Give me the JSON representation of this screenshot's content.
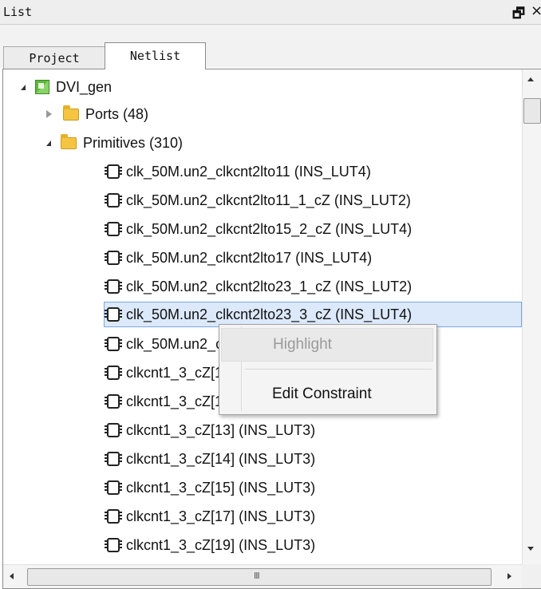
{
  "window": {
    "title": "List",
    "float_icon": "float-icon",
    "close_icon": "close-icon"
  },
  "tabs": [
    {
      "label": "Project",
      "active": false
    },
    {
      "label": "Netlist",
      "active": true
    }
  ],
  "tree": {
    "root": {
      "label": "DVI_gen",
      "icon": "design-icon",
      "expanded": true
    },
    "ports": {
      "label": "Ports (48)",
      "icon": "folder-icon",
      "expanded": false
    },
    "primitives": {
      "label": "Primitives (310)",
      "icon": "folder-icon",
      "expanded": true
    },
    "items": [
      {
        "label": "clk_50M.un2_clkcnt2lto11  (INS_LUT4)"
      },
      {
        "label": "clk_50M.un2_clkcnt2lto11_1_cZ  (INS_LUT2)"
      },
      {
        "label": "clk_50M.un2_clkcnt2lto15_2_cZ  (INS_LUT4)"
      },
      {
        "label": "clk_50M.un2_clkcnt2lto17  (INS_LUT4)"
      },
      {
        "label": "clk_50M.un2_clkcnt2lto23_1_cZ  (INS_LUT2)"
      },
      {
        "label": "clk_50M.un2_clkcnt2lto23_3_cZ  (INS_LUT4)",
        "selected": true
      },
      {
        "label": "clk_50M.un2_clkcnt2lto23_4_cZ  (INS_LUT4)"
      },
      {
        "label": "clkcnt1_3_cZ[11]  (INS_LUT3)"
      },
      {
        "label": "clkcnt1_3_cZ[12]  (INS_LUT3)"
      },
      {
        "label": "clkcnt1_3_cZ[13]  (INS_LUT3)"
      },
      {
        "label": "clkcnt1_3_cZ[14]  (INS_LUT3)"
      },
      {
        "label": "clkcnt1_3_cZ[15]  (INS_LUT3)"
      },
      {
        "label": "clkcnt1_3_cZ[17]  (INS_LUT3)"
      },
      {
        "label": "clkcnt1_3_cZ[19]  (INS_LUT3)"
      }
    ]
  },
  "context_menu": {
    "highlight": "Highlight",
    "edit_constraint": "Edit Constraint"
  },
  "scrollbar": {
    "h_grip": "III"
  },
  "colors": {
    "selection_bg": "#dce9fb",
    "selection_border": "#7aa7e6",
    "disabled_text": "#9a9a9a"
  }
}
